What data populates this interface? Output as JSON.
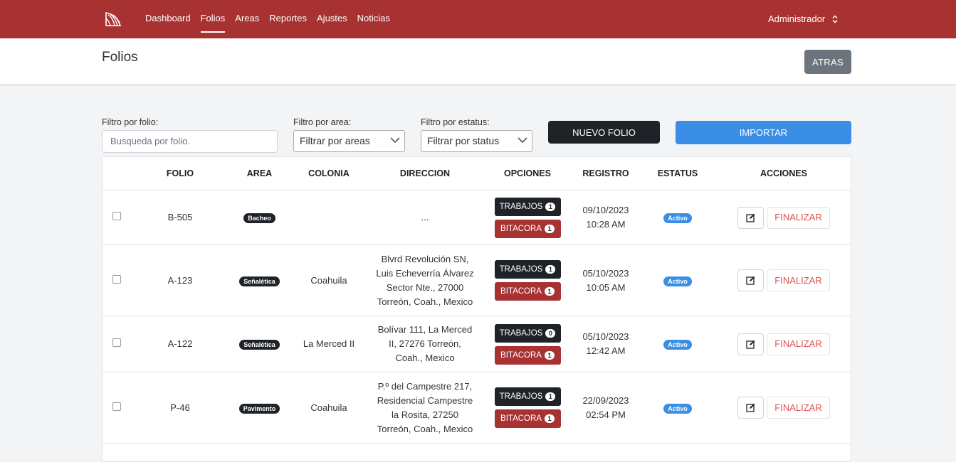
{
  "nav": {
    "links": [
      "Dashboard",
      "Folios",
      "Areas",
      "Reportes",
      "Ajustes",
      "Noticias"
    ],
    "active": "Folios",
    "user": "Administrador"
  },
  "header": {
    "title": "Folios",
    "back_label": "ATRAS"
  },
  "filters": {
    "folio_label": "Filtro por folio:",
    "folio_placeholder": "Busqueda por folio.",
    "area_label": "Filtro por area:",
    "area_value": "Filtrar por areas",
    "status_label": "Filtro por estatus:",
    "status_value": "Filtrar por status",
    "new_label": "NUEVO FOLIO",
    "import_label": "IMPORTAR"
  },
  "table": {
    "headers": [
      "",
      "FOLIO",
      "AREA",
      "COLONIA",
      "DIRECCION",
      "OPCIONES",
      "REGISTRO",
      "ESTATUS",
      "ACCIONES"
    ],
    "trabajos_label": "TRABAJOS",
    "bitacora_label": "BITACORA",
    "finalizar_label": "FINALIZAR",
    "rows": [
      {
        "folio": "B-505",
        "area": "Bacheo",
        "colonia": "",
        "direccion": [
          "..."
        ],
        "trabajos": "1",
        "bitacora": "1",
        "fecha": "09/10/2023",
        "hora": "10:28 AM",
        "estatus": "Activo"
      },
      {
        "folio": "A-123",
        "area": "Señalética",
        "colonia": "Coahuila",
        "direccion": [
          "Blvrd Revolución SN,",
          "Luis Echeverría Álvarez",
          "Sector Nte., 27000",
          "Torreón, Coah., Mexico"
        ],
        "trabajos": "1",
        "bitacora": "1",
        "fecha": "05/10/2023",
        "hora": "10:05 AM",
        "estatus": "Activo"
      },
      {
        "folio": "A-122",
        "area": "Señalética",
        "colonia": "La Merced II",
        "direccion": [
          "Bolívar 111, La Merced",
          "II, 27276 Torreón,",
          "Coah., Mexico"
        ],
        "trabajos": "0",
        "bitacora": "1",
        "fecha": "05/10/2023",
        "hora": "12:42 AM",
        "estatus": "Activo"
      },
      {
        "folio": "P-46",
        "area": "Pavimento",
        "colonia": "Coahuila",
        "direccion": [
          "P.º del Campestre 217,",
          "Residencial Campestre",
          "la Rosita, 27250",
          "Torreón, Coah., Mexico"
        ],
        "trabajos": "1",
        "bitacora": "1",
        "fecha": "22/09/2023",
        "hora": "02:54 PM",
        "estatus": "Activo"
      }
    ]
  }
}
